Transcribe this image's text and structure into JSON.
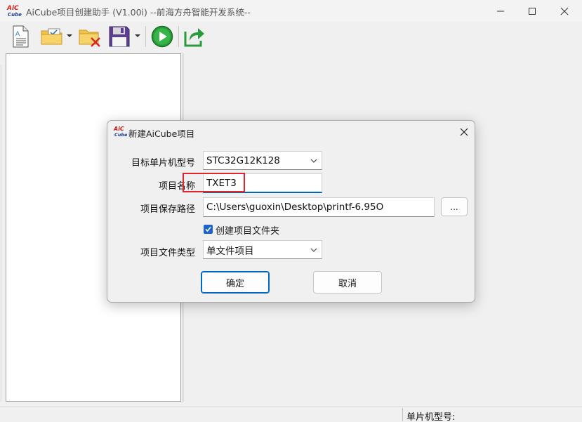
{
  "window": {
    "title": "AiCube项目创建助手 (V1.00i) --前海方舟智能开发系统--",
    "logo_text_top": "AiC",
    "logo_text_bottom": "Cube"
  },
  "toolbar": {
    "items": [
      {
        "name": "new-document",
        "icon": "document-icon"
      },
      {
        "name": "open-project",
        "icon": "folder-open-icon",
        "has_dropdown": true
      },
      {
        "name": "close-project",
        "icon": "folder-delete-icon"
      },
      {
        "name": "save-project",
        "icon": "save-icon",
        "has_dropdown": true
      },
      {
        "name": "run",
        "icon": "play-icon"
      },
      {
        "name": "export",
        "icon": "share-icon"
      }
    ]
  },
  "statusbar": {
    "mcu_label": "单片机型号:"
  },
  "dialog": {
    "title": "新建AiCube项目",
    "mcu_model_label": "目标单片机型号",
    "mcu_model_value": "STC32G12K128",
    "project_name_label": "项目名称",
    "project_name_value": "TXET3",
    "save_path_label": "项目保存路径",
    "save_path_value": "C:\\Users\\guoxin\\Desktop\\printf-6.95O",
    "browse_label": "...",
    "create_folder_label": "创建项目文件夹",
    "create_folder_checked": true,
    "file_type_label": "项目文件类型",
    "file_type_value": "单文件项目",
    "ok_label": "确定",
    "cancel_label": "取消"
  },
  "colors": {
    "accent": "#0067c0",
    "highlight_box": "#e0262c",
    "checkbox": "#1d64c8",
    "play_green": "#2a9d3a"
  }
}
